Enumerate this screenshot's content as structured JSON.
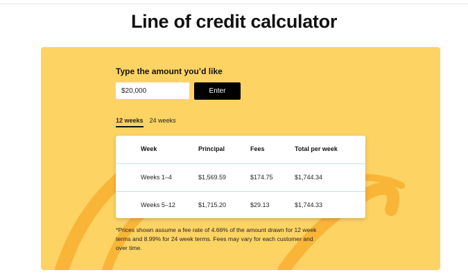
{
  "page": {
    "title": "Line of credit calculator"
  },
  "calculator": {
    "amount_label": "Type the amount you’d like",
    "amount_value": "$20,000",
    "enter_label": "Enter",
    "tabs": [
      {
        "label": "12 weeks",
        "active": true
      },
      {
        "label": "24 weeks",
        "active": false
      }
    ],
    "table": {
      "headers": [
        "Week",
        "Principal",
        "Fees",
        "Total per week"
      ],
      "rows": [
        [
          "Weeks 1–4",
          "$1,569.59",
          "$174.75",
          "$1,744.34"
        ],
        [
          "Weeks 5–12",
          "$1,715.20",
          "$29.13",
          "$1,744.33"
        ]
      ]
    },
    "footnote": "*Prices shown assume a fee rate of 4.66% of the amount drawn for 12 week terms and 8.99% for 24 week terms. Fees may vary for each customer and over time."
  },
  "colors": {
    "panel_background": "#fdd363",
    "swirl": "#f9b233",
    "button_background": "#000000",
    "row_divider": "#bfe3ec"
  }
}
